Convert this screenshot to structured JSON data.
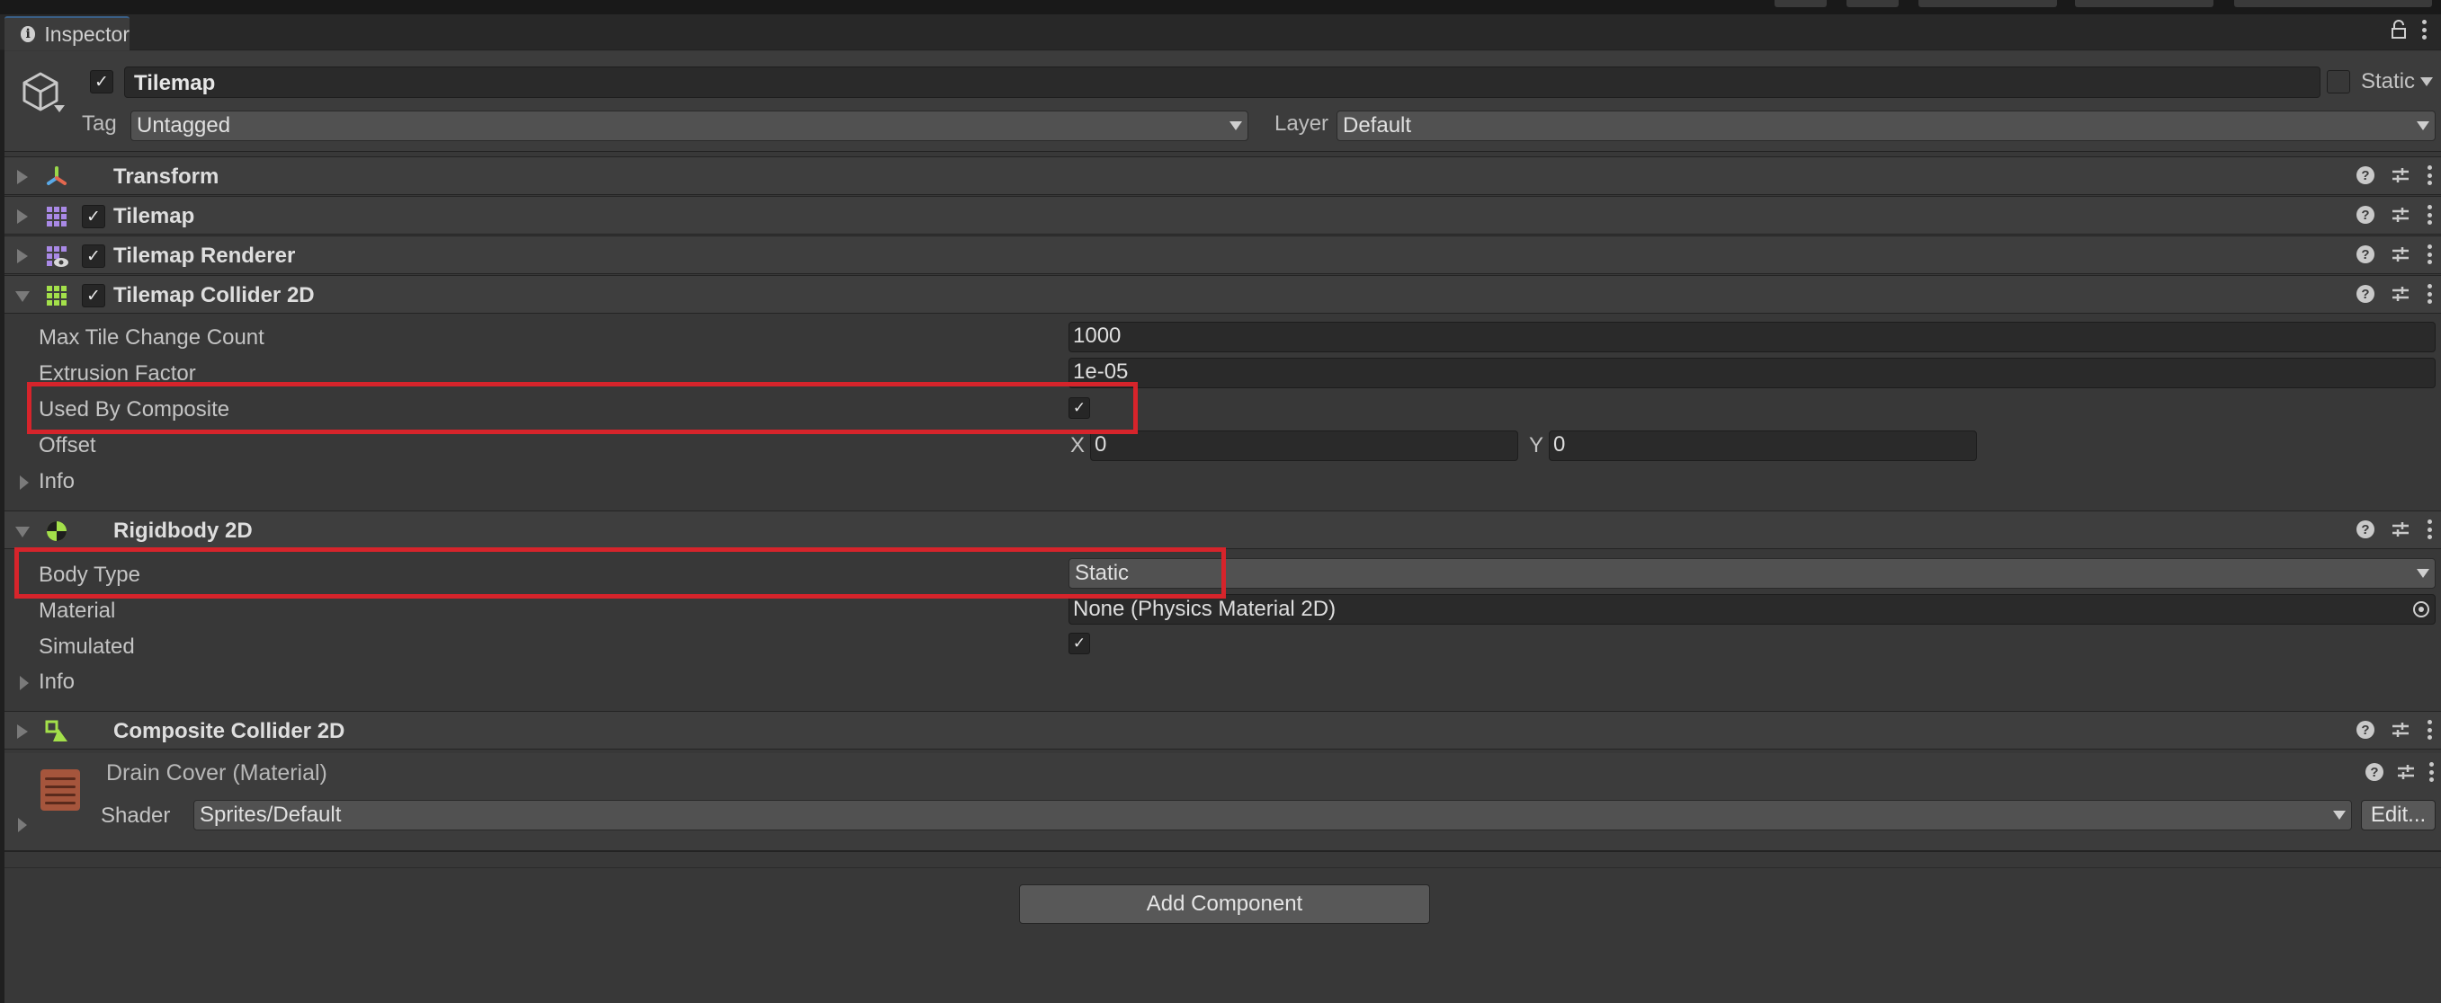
{
  "tab": {
    "label": "Inspector"
  },
  "gameobject": {
    "active": true,
    "name": "Tilemap",
    "static_label": "Static",
    "static_checked": false,
    "tag_label": "Tag",
    "tag_value": "Untagged",
    "layer_label": "Layer",
    "layer_value": "Default"
  },
  "components": [
    {
      "title": "Transform",
      "expanded": false,
      "has_checkbox": false,
      "icon": "transform-icon"
    },
    {
      "title": "Tilemap",
      "expanded": false,
      "has_checkbox": true,
      "enabled": true,
      "icon": "tilemap-icon"
    },
    {
      "title": "Tilemap Renderer",
      "expanded": false,
      "has_checkbox": true,
      "enabled": true,
      "icon": "tilemap-renderer-icon"
    },
    {
      "title": "Tilemap Collider 2D",
      "expanded": true,
      "has_checkbox": true,
      "enabled": true,
      "icon": "tilemap-collider-icon"
    },
    {
      "title": "Rigidbody 2D",
      "expanded": true,
      "has_checkbox": false,
      "icon": "rigidbody-icon"
    },
    {
      "title": "Composite Collider 2D",
      "expanded": false,
      "has_checkbox": false,
      "icon": "composite-collider-icon"
    }
  ],
  "tilemap_collider": {
    "max_tile_change_count_label": "Max Tile Change Count",
    "max_tile_change_count": "1000",
    "extrusion_factor_label": "Extrusion Factor",
    "extrusion_factor": "1e-05",
    "used_by_composite_label": "Used By Composite",
    "used_by_composite": true,
    "offset_label": "Offset",
    "offset_x_label": "X",
    "offset_x": "0",
    "offset_y_label": "Y",
    "offset_y": "0",
    "info_label": "Info"
  },
  "rigidbody": {
    "body_type_label": "Body Type",
    "body_type": "Static",
    "material_label": "Material",
    "material_value": "None (Physics Material 2D)",
    "simulated_label": "Simulated",
    "simulated": true,
    "info_label": "Info"
  },
  "material": {
    "title": "Drain Cover (Material)",
    "shader_label": "Shader",
    "shader_value": "Sprites/Default",
    "edit_label": "Edit..."
  },
  "add_component_label": "Add Component",
  "colors": {
    "highlight": "#d6242b",
    "tab_accent": "#3a5f86"
  }
}
